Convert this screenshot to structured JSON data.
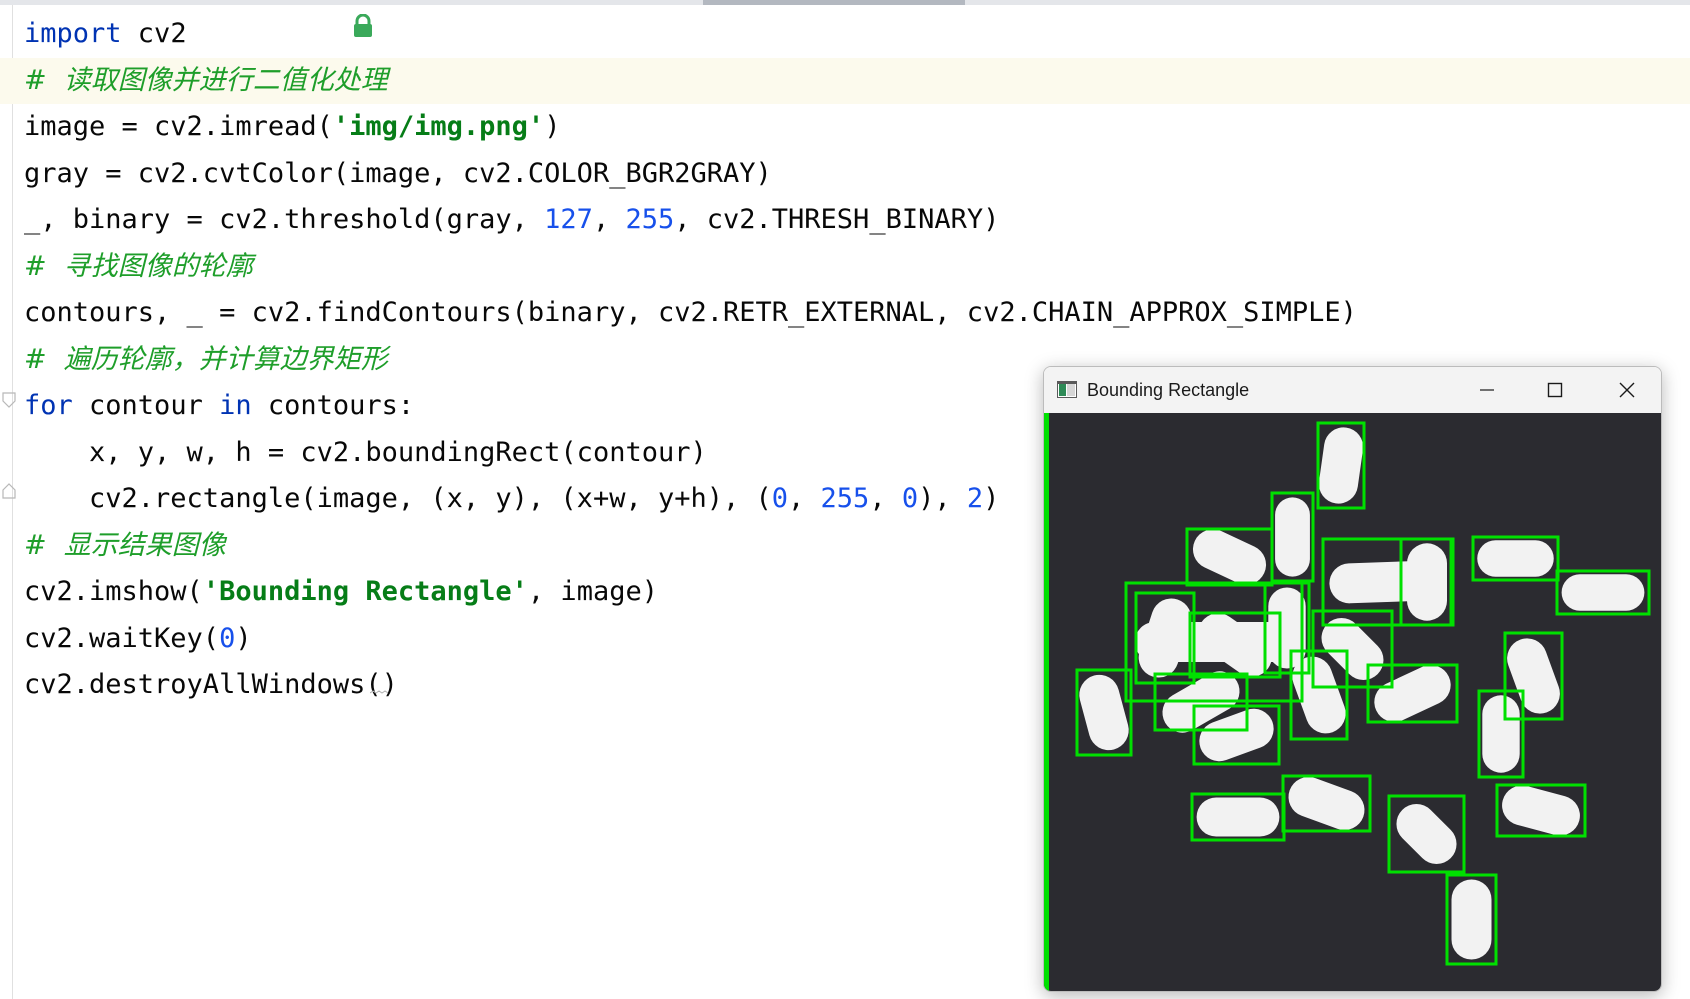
{
  "editor": {
    "lines": [
      {
        "tokens": [
          {
            "t": "import",
            "c": "kw"
          },
          {
            "t": " cv2",
            "c": ""
          }
        ]
      },
      {
        "highlight": true,
        "tokens": [
          {
            "t": "#  读取图像并进行二值化处理",
            "c": "cmt"
          }
        ]
      },
      {
        "tokens": [
          {
            "t": "image = cv2.imread(",
            "c": ""
          },
          {
            "t": "'img/img.png'",
            "c": "str"
          },
          {
            "t": ")",
            "c": ""
          }
        ]
      },
      {
        "tokens": [
          {
            "t": "gray = cv2.cvtColor(image, cv2.COLOR_BGR2GRAY)",
            "c": ""
          }
        ]
      },
      {
        "tokens": [
          {
            "t": "_, binary = cv2.threshold(gray, ",
            "c": ""
          },
          {
            "t": "127",
            "c": "num"
          },
          {
            "t": ", ",
            "c": ""
          },
          {
            "t": "255",
            "c": "num"
          },
          {
            "t": ", cv2.THRESH_BINARY)",
            "c": ""
          }
        ]
      },
      {
        "tokens": [
          {
            "t": "#  寻找图像的轮廓",
            "c": "cmt"
          }
        ]
      },
      {
        "tokens": [
          {
            "t": "contours, _ = cv2.findContours(binary, cv2.RETR_EXTERNAL, cv2.CHAIN_APPROX_SIMPLE)",
            "c": ""
          }
        ]
      },
      {
        "tokens": [
          {
            "t": "#  遍历轮廓，并计算边界矩形",
            "c": "cmt"
          }
        ]
      },
      {
        "tokens": [
          {
            "t": "for",
            "c": "kw"
          },
          {
            "t": " contour ",
            "c": ""
          },
          {
            "t": "in",
            "c": "kw"
          },
          {
            "t": " contours:",
            "c": ""
          }
        ]
      },
      {
        "tokens": [
          {
            "t": "    x, y, w, h = cv2.boundingRect(contour)",
            "c": ""
          }
        ]
      },
      {
        "tokens": [
          {
            "t": "    cv2.rectangle(image, (x, y), (x+w, y+h), (",
            "c": ""
          },
          {
            "t": "0",
            "c": "num"
          },
          {
            "t": ", ",
            "c": ""
          },
          {
            "t": "255",
            "c": "num"
          },
          {
            "t": ", ",
            "c": ""
          },
          {
            "t": "0",
            "c": "num"
          },
          {
            "t": "), ",
            "c": ""
          },
          {
            "t": "2",
            "c": "num"
          },
          {
            "t": ")",
            "c": ""
          }
        ]
      },
      {
        "tokens": [
          {
            "t": "#  显示结果图像",
            "c": "cmt"
          }
        ]
      },
      {
        "tokens": [
          {
            "t": "cv2.imshow(",
            "c": ""
          },
          {
            "t": "'Bounding Rectangle'",
            "c": "str"
          },
          {
            "t": ", image)",
            "c": ""
          }
        ]
      },
      {
        "tokens": [
          {
            "t": "cv2.waitKey(",
            "c": ""
          },
          {
            "t": "0",
            "c": "num"
          },
          {
            "t": ")",
            "c": ""
          }
        ]
      },
      {
        "tokens": [
          {
            "t": "cv2.destroyAllWindows()",
            "c": ""
          }
        ]
      }
    ]
  },
  "cv_window": {
    "title": "Bounding Rectangle",
    "minimize_icon": "minimize-icon",
    "maximize_icon": "maximize-icon",
    "close_icon": "close-icon",
    "box_color": "#00e000",
    "pill_color": "#f2f2f2",
    "background_color": "#2b2b30"
  },
  "colors": {
    "keyword": "#0033b3",
    "string": "#067d17",
    "number": "#1750eb",
    "comment": "#1e9e2a",
    "highlight_line": "#fcfaed"
  }
}
